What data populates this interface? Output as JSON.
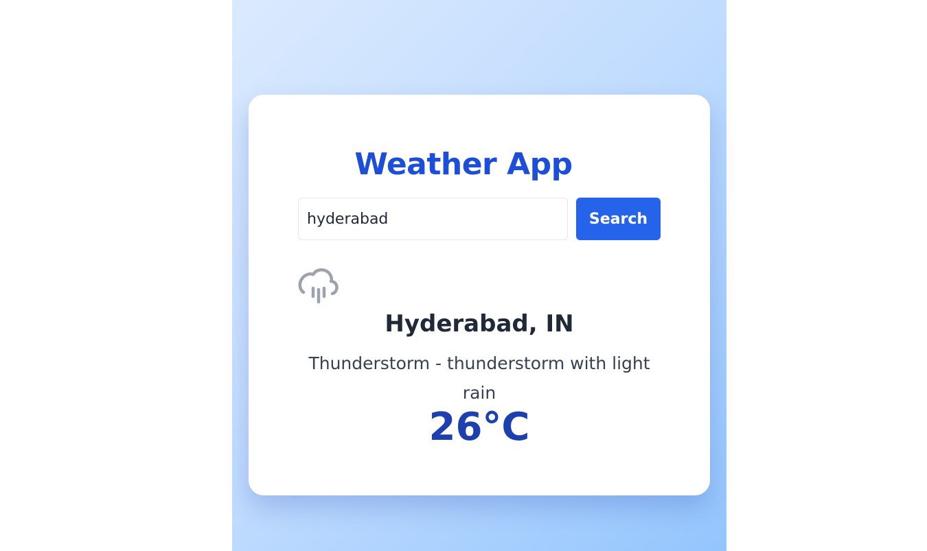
{
  "app": {
    "title": "Weather App"
  },
  "search": {
    "value": "hyderabad",
    "button_label": "Search"
  },
  "weather": {
    "icon": "cloud-rain-icon",
    "city": "Hyderabad, IN",
    "description": "Thunderstorm - thunderstorm with light rain",
    "temperature": "26°C"
  },
  "colors": {
    "accent": "#1d4ed8",
    "button": "#2563eb",
    "temperature": "#1e40af",
    "icon": "#9ca3af"
  }
}
